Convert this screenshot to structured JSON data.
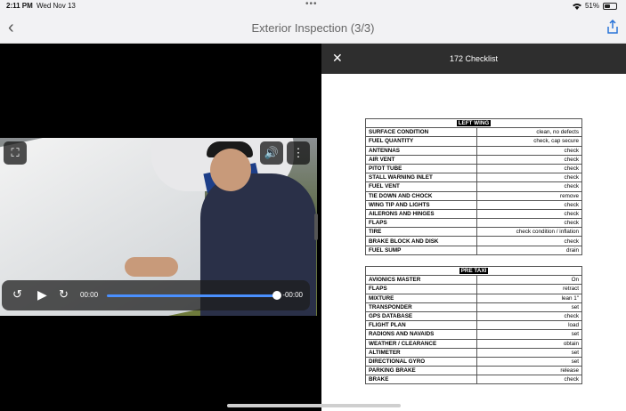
{
  "status": {
    "time": "2:11 PM",
    "date": "Wed Nov 13",
    "battery": "51%"
  },
  "nav": {
    "title": "Exterior Inspection (3/3)"
  },
  "player": {
    "elapsed": "00:00",
    "remaining": "-00:00",
    "progress": 0.97
  },
  "doc": {
    "title": "172 Checklist",
    "sections": [
      {
        "title": "LEFT WING",
        "rows": [
          {
            "item": "SURFACE CONDITION",
            "action": "clean, no defects"
          },
          {
            "item": "FUEL QUANTITY",
            "action": "check, cap secure"
          },
          {
            "item": "ANTENNAS",
            "action": "check"
          },
          {
            "item": "AIR VENT",
            "action": "check"
          },
          {
            "item": "PITOT TUBE",
            "action": "check"
          },
          {
            "item": "STALL WARNING INLET",
            "action": "check"
          },
          {
            "item": "FUEL VENT",
            "action": "check"
          },
          {
            "item": "TIE DOWN AND CHOCK",
            "action": "remove"
          },
          {
            "item": "WING TIP AND LIGHTS",
            "action": "check"
          },
          {
            "item": "AILERONS AND HINGES",
            "action": "check"
          },
          {
            "item": "FLAPS",
            "action": "check"
          },
          {
            "item": "TIRE",
            "action": "check condition / inflation"
          },
          {
            "item": "BRAKE BLOCK AND DISK",
            "action": "check"
          },
          {
            "item": "FUEL SUMP",
            "action": "drain"
          }
        ]
      },
      {
        "title": "PRE TAXI",
        "rows": [
          {
            "item": "AVIONICS MASTER",
            "action": "On"
          },
          {
            "item": "FLAPS",
            "action": "retract"
          },
          {
            "item": "MIXTURE",
            "action": "lean 1\""
          },
          {
            "item": "TRANSPONDER",
            "action": "set"
          },
          {
            "item": "GPS DATABASE",
            "action": "check"
          },
          {
            "item": "FLIGHT PLAN",
            "action": "load"
          },
          {
            "item": "RADIONS AND NAVAIDS",
            "action": "set"
          },
          {
            "item": "WEATHER / CLEARANCE",
            "action": "obtain"
          },
          {
            "item": "ALTIMETER",
            "action": "set"
          },
          {
            "item": "DIRECTIONAL GYRO",
            "action": "set"
          },
          {
            "item": "PARKING BRAKE",
            "action": "release"
          },
          {
            "item": "BRAKE",
            "action": "check"
          }
        ]
      }
    ]
  }
}
